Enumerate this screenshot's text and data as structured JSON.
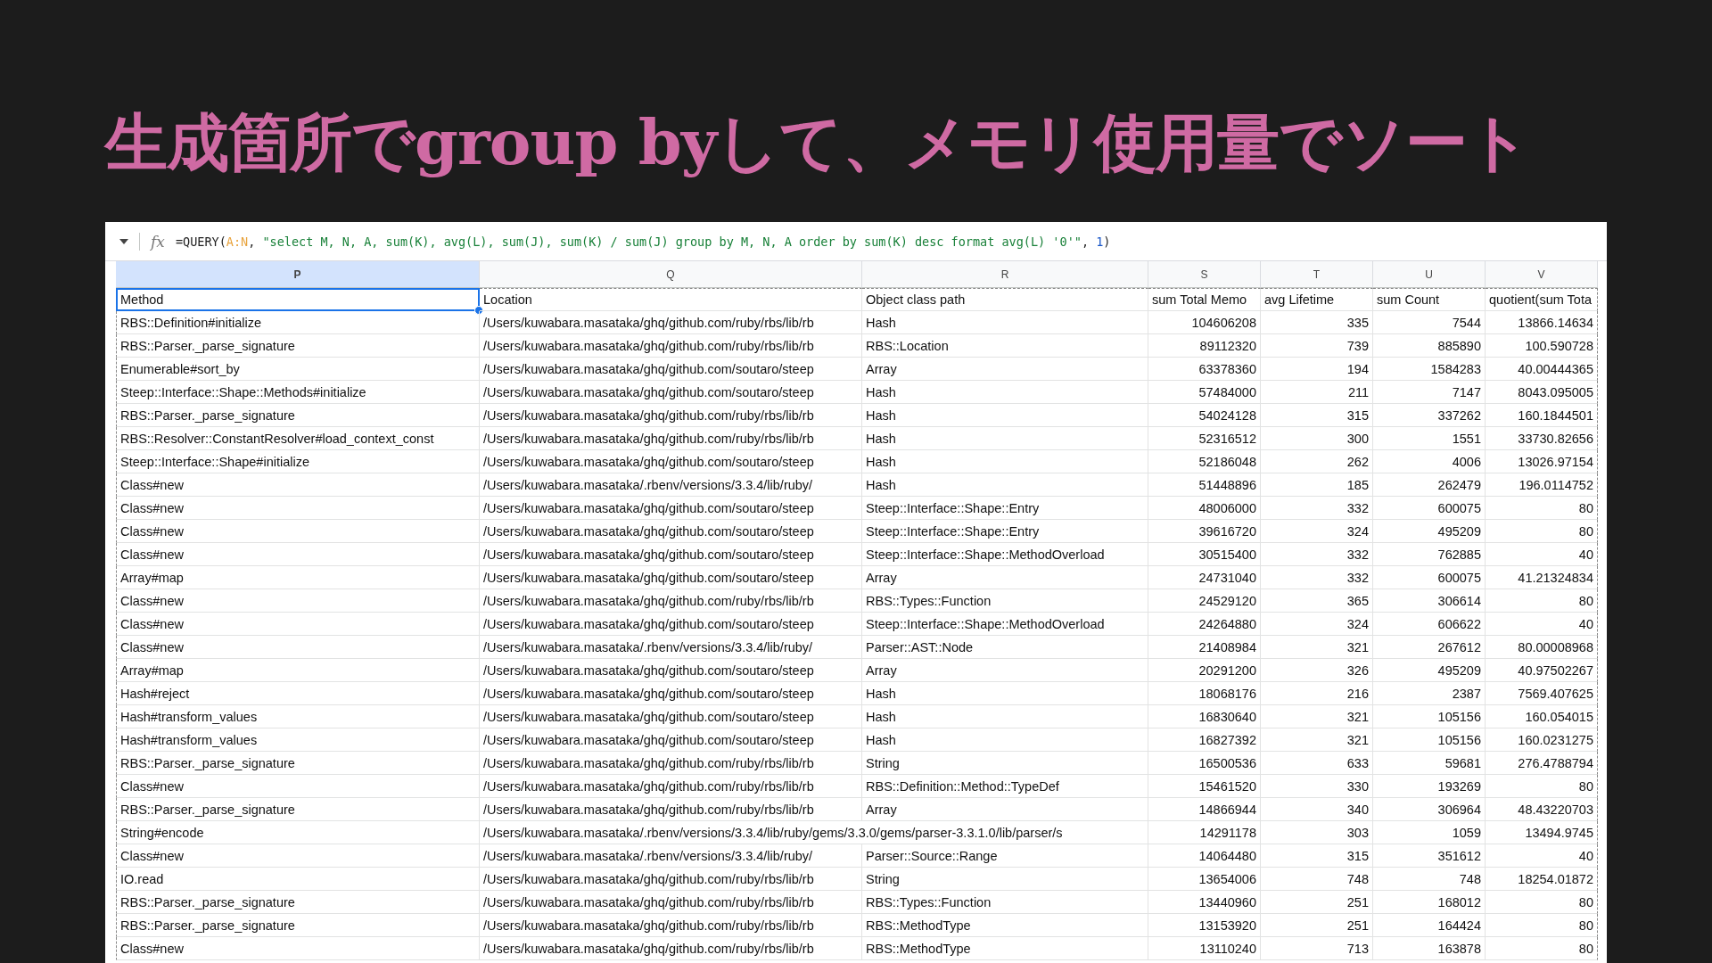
{
  "slide_title": "生成箇所でgroup byして、メモリ使用量でソート",
  "formula_bar": {
    "icon_label": "fx",
    "parts": [
      {
        "text": "=QUERY(",
        "kind": "plain"
      },
      {
        "text": "A:N",
        "kind": "range"
      },
      {
        "text": ", ",
        "kind": "plain"
      },
      {
        "text": "\"select M, N, A, sum(K), avg(L), sum(J), sum(K) / sum(J) group by M, N, A order by sum(K) desc format avg(L) '0'\"",
        "kind": "string"
      },
      {
        "text": ", ",
        "kind": "plain"
      },
      {
        "text": "1",
        "kind": "number"
      },
      {
        "text": ")",
        "kind": "plain"
      }
    ]
  },
  "column_letters": [
    {
      "label": "P",
      "selected": true
    },
    {
      "label": "Q",
      "selected": false
    },
    {
      "label": "R",
      "selected": false
    },
    {
      "label": "S",
      "selected": false
    },
    {
      "label": "T",
      "selected": false
    },
    {
      "label": "U",
      "selected": false
    },
    {
      "label": "V",
      "selected": false
    }
  ],
  "header_row": [
    {
      "text": "Method",
      "selected": true
    },
    {
      "text": "Location",
      "selected": false
    },
    {
      "text": "Object class path",
      "selected": false
    },
    {
      "text": "sum Total Memo",
      "selected": false
    },
    {
      "text": "avg Lifetime",
      "selected": false
    },
    {
      "text": "sum Count",
      "selected": false
    },
    {
      "text": "quotient(sum Tota",
      "selected": false
    }
  ],
  "rows": [
    {
      "method": "RBS::Definition#initialize",
      "location": "/Users/kuwabara.masataka/ghq/github.com/ruby/rbs/lib/rb",
      "object_class": "Hash",
      "sum_memory": "104606208",
      "avg_lifetime": "335",
      "sum_count": "7544",
      "quotient": "13866.14634"
    },
    {
      "method": "RBS::Parser._parse_signature",
      "location": "/Users/kuwabara.masataka/ghq/github.com/ruby/rbs/lib/rb",
      "object_class": "RBS::Location",
      "sum_memory": "89112320",
      "avg_lifetime": "739",
      "sum_count": "885890",
      "quotient": "100.590728"
    },
    {
      "method": "Enumerable#sort_by",
      "location": "/Users/kuwabara.masataka/ghq/github.com/soutaro/steep",
      "object_class": "Array",
      "sum_memory": "63378360",
      "avg_lifetime": "194",
      "sum_count": "1584283",
      "quotient": "40.00444365"
    },
    {
      "method": "Steep::Interface::Shape::Methods#initialize",
      "location": "/Users/kuwabara.masataka/ghq/github.com/soutaro/steep",
      "object_class": "Hash",
      "sum_memory": "57484000",
      "avg_lifetime": "211",
      "sum_count": "7147",
      "quotient": "8043.095005"
    },
    {
      "method": "RBS::Parser._parse_signature",
      "location": "/Users/kuwabara.masataka/ghq/github.com/ruby/rbs/lib/rb",
      "object_class": "Hash",
      "sum_memory": "54024128",
      "avg_lifetime": "315",
      "sum_count": "337262",
      "quotient": "160.1844501"
    },
    {
      "method": "RBS::Resolver::ConstantResolver#load_context_const",
      "location": "/Users/kuwabara.masataka/ghq/github.com/ruby/rbs/lib/rb",
      "object_class": "Hash",
      "sum_memory": "52316512",
      "avg_lifetime": "300",
      "sum_count": "1551",
      "quotient": "33730.82656"
    },
    {
      "method": "Steep::Interface::Shape#initialize",
      "location": "/Users/kuwabara.masataka/ghq/github.com/soutaro/steep",
      "object_class": "Hash",
      "sum_memory": "52186048",
      "avg_lifetime": "262",
      "sum_count": "4006",
      "quotient": "13026.97154"
    },
    {
      "method": "Class#new",
      "location": "/Users/kuwabara.masataka/.rbenv/versions/3.3.4/lib/ruby/",
      "object_class": "Hash",
      "sum_memory": "51448896",
      "avg_lifetime": "185",
      "sum_count": "262479",
      "quotient": "196.0114752"
    },
    {
      "method": "Class#new",
      "location": "/Users/kuwabara.masataka/ghq/github.com/soutaro/steep",
      "object_class": "Steep::Interface::Shape::Entry",
      "sum_memory": "48006000",
      "avg_lifetime": "332",
      "sum_count": "600075",
      "quotient": "80"
    },
    {
      "method": "Class#new",
      "location": "/Users/kuwabara.masataka/ghq/github.com/soutaro/steep",
      "object_class": "Steep::Interface::Shape::Entry",
      "sum_memory": "39616720",
      "avg_lifetime": "324",
      "sum_count": "495209",
      "quotient": "80"
    },
    {
      "method": "Class#new",
      "location": "/Users/kuwabara.masataka/ghq/github.com/soutaro/steep",
      "object_class": "Steep::Interface::Shape::MethodOverload",
      "sum_memory": "30515400",
      "avg_lifetime": "332",
      "sum_count": "762885",
      "quotient": "40"
    },
    {
      "method": "Array#map",
      "location": "/Users/kuwabara.masataka/ghq/github.com/soutaro/steep",
      "object_class": "Array",
      "sum_memory": "24731040",
      "avg_lifetime": "332",
      "sum_count": "600075",
      "quotient": "41.21324834"
    },
    {
      "method": "Class#new",
      "location": "/Users/kuwabara.masataka/ghq/github.com/ruby/rbs/lib/rb",
      "object_class": "RBS::Types::Function",
      "sum_memory": "24529120",
      "avg_lifetime": "365",
      "sum_count": "306614",
      "quotient": "80"
    },
    {
      "method": "Class#new",
      "location": "/Users/kuwabara.masataka/ghq/github.com/soutaro/steep",
      "object_class": "Steep::Interface::Shape::MethodOverload",
      "sum_memory": "24264880",
      "avg_lifetime": "324",
      "sum_count": "606622",
      "quotient": "40"
    },
    {
      "method": "Class#new",
      "location": "/Users/kuwabara.masataka/.rbenv/versions/3.3.4/lib/ruby/",
      "object_class": "Parser::AST::Node",
      "sum_memory": "21408984",
      "avg_lifetime": "321",
      "sum_count": "267612",
      "quotient": "80.00008968"
    },
    {
      "method": "Array#map",
      "location": "/Users/kuwabara.masataka/ghq/github.com/soutaro/steep",
      "object_class": "Array",
      "sum_memory": "20291200",
      "avg_lifetime": "326",
      "sum_count": "495209",
      "quotient": "40.97502267"
    },
    {
      "method": "Hash#reject",
      "location": "/Users/kuwabara.masataka/ghq/github.com/soutaro/steep",
      "object_class": "Hash",
      "sum_memory": "18068176",
      "avg_lifetime": "216",
      "sum_count": "2387",
      "quotient": "7569.407625"
    },
    {
      "method": "Hash#transform_values",
      "location": "/Users/kuwabara.masataka/ghq/github.com/soutaro/steep",
      "object_class": "Hash",
      "sum_memory": "16830640",
      "avg_lifetime": "321",
      "sum_count": "105156",
      "quotient": "160.054015"
    },
    {
      "method": "Hash#transform_values",
      "location": "/Users/kuwabara.masataka/ghq/github.com/soutaro/steep",
      "object_class": "Hash",
      "sum_memory": "16827392",
      "avg_lifetime": "321",
      "sum_count": "105156",
      "quotient": "160.0231275"
    },
    {
      "method": "RBS::Parser._parse_signature",
      "location": "/Users/kuwabara.masataka/ghq/github.com/ruby/rbs/lib/rb",
      "object_class": "String",
      "sum_memory": "16500536",
      "avg_lifetime": "633",
      "sum_count": "59681",
      "quotient": "276.4788794"
    },
    {
      "method": "Class#new",
      "location": "/Users/kuwabara.masataka/ghq/github.com/ruby/rbs/lib/rb",
      "object_class": "RBS::Definition::Method::TypeDef",
      "sum_memory": "15461520",
      "avg_lifetime": "330",
      "sum_count": "193269",
      "quotient": "80"
    },
    {
      "method": "RBS::Parser._parse_signature",
      "location": "/Users/kuwabara.masataka/ghq/github.com/ruby/rbs/lib/rb",
      "object_class": "Array",
      "sum_memory": "14866944",
      "avg_lifetime": "340",
      "sum_count": "306964",
      "quotient": "48.43220703"
    },
    {
      "method": "String#encode",
      "location": "/Users/kuwabara.masataka/.rbenv/versions/3.3.4/lib/ruby/gems/3.3.0/gems/parser-3.3.1.0/lib/parser/s",
      "sum_memory": "14291178",
      "avg_lifetime": "303",
      "sum_count": "1059",
      "quotient": "13494.9745"
    },
    {
      "method": "Class#new",
      "location": "/Users/kuwabara.masataka/.rbenv/versions/3.3.4/lib/ruby/",
      "object_class": "Parser::Source::Range",
      "sum_memory": "14064480",
      "avg_lifetime": "315",
      "sum_count": "351612",
      "quotient": "40"
    },
    {
      "method": "IO.read",
      "location": "/Users/kuwabara.masataka/ghq/github.com/ruby/rbs/lib/rb",
      "object_class": "String",
      "sum_memory": "13654006",
      "avg_lifetime": "748",
      "sum_count": "748",
      "quotient": "18254.01872"
    },
    {
      "method": "RBS::Parser._parse_signature",
      "location": "/Users/kuwabara.masataka/ghq/github.com/ruby/rbs/lib/rb",
      "object_class": "RBS::Types::Function",
      "sum_memory": "13440960",
      "avg_lifetime": "251",
      "sum_count": "168012",
      "quotient": "80"
    },
    {
      "method": "RBS::Parser._parse_signature",
      "location": "/Users/kuwabara.masataka/ghq/github.com/ruby/rbs/lib/rb",
      "object_class": "RBS::MethodType",
      "sum_memory": "13153920",
      "avg_lifetime": "251",
      "sum_count": "164424",
      "quotient": "80"
    },
    {
      "method": "Class#new",
      "location": "/Users/kuwabara.masataka/ghq/github.com/ruby/rbs/lib/rb",
      "object_class": "RBS::MethodType",
      "sum_memory": "13110240",
      "avg_lifetime": "713",
      "sum_count": "163878",
      "quotient": "80"
    }
  ]
}
